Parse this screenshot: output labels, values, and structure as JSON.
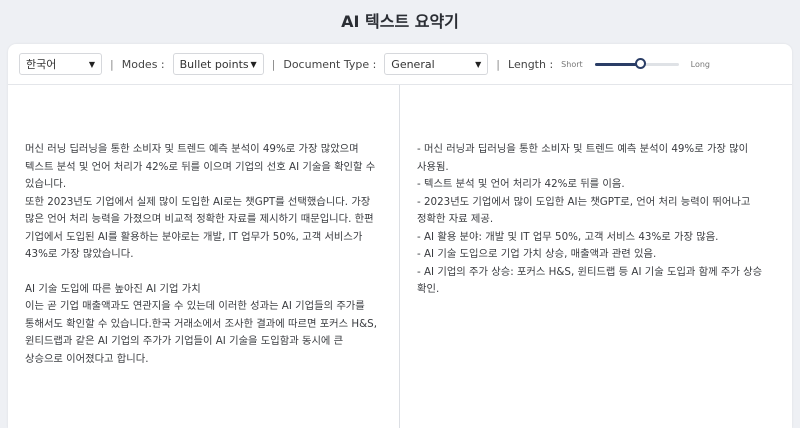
{
  "app": {
    "title": "AI 텍스트 요약기"
  },
  "toolbar": {
    "language": "한국어",
    "modes_label": "Modes :",
    "modes_value": "Bullet points",
    "doctype_label": "Document Type :",
    "doctype_value": "General",
    "length_label": "Length :",
    "length_min_label": "Short",
    "length_max_label": "Long",
    "length_value": 0.55,
    "separator": "|"
  },
  "input": {
    "paragraphs": [
      "머신 러닝 딥러닝을 통한 소비자 및 트렌드 예측 분석이 49%로 가장 많았으며 텍스트 분석 및 언어 처리가 42%로 뒤를 이으며 기업의 선호 AI 기술을 확인할 수 있습니다.",
      "또한 2023년도 기업에서 실제 많이 도입한 AI로는 챗GPT를 선택했습니다. 가장 많은 언어 처리 능력을 가졌으며 비교적 정확한 자료를 제시하기 때문입니다. 한편 기업에서 도입된 AI를 활용하는 분야로는 개발, IT 업무가 50%, 고객 서비스가 43%로 가장 많았습니다.",
      "",
      "AI 기술 도입에 따른 높아진 AI 기업 가치",
      "이는 곧 기업 매출액과도 연관지을 수 있는데 이러한 성과는 AI 기업들의 주가를 통해서도 확인할 수 있습니다.한국 거래소에서 조사한 결과에 따르면 포커스 H&S, 윈티드랩과 같은 AI 기업의 주가가 기업들이 AI 기술을 도입함과 동시에 큰 상승으로 이어졌다고 합니다."
    ]
  },
  "output": {
    "bullets": [
      "- 머신 러닝과 딥러닝을 통한 소비자 및 트렌드 예측 분석이 49%로 가장 많이 사용됨.",
      "- 텍스트 분석 및 언어 처리가 42%로 뒤를 이음.",
      "- 2023년도 기업에서 많이 도입한 AI는 챗GPT로, 언어 처리 능력이 뛰어나고 정확한 자료 제공.",
      "- AI 활용 분야: 개발 및 IT 업무 50%, 고객 서비스 43%로 가장 많음.",
      "- AI 기술 도입으로 기업 가치 상승, 매출액과 관련 있음.",
      "- AI 기업의 주가 상승: 포커스 H&S, 윈티드랩 등 AI 기술 도입과 함께 주가 상승 확인."
    ]
  },
  "colors": {
    "accent": "#2a3d66",
    "background": "#eef0f4",
    "card": "#ffffff"
  }
}
